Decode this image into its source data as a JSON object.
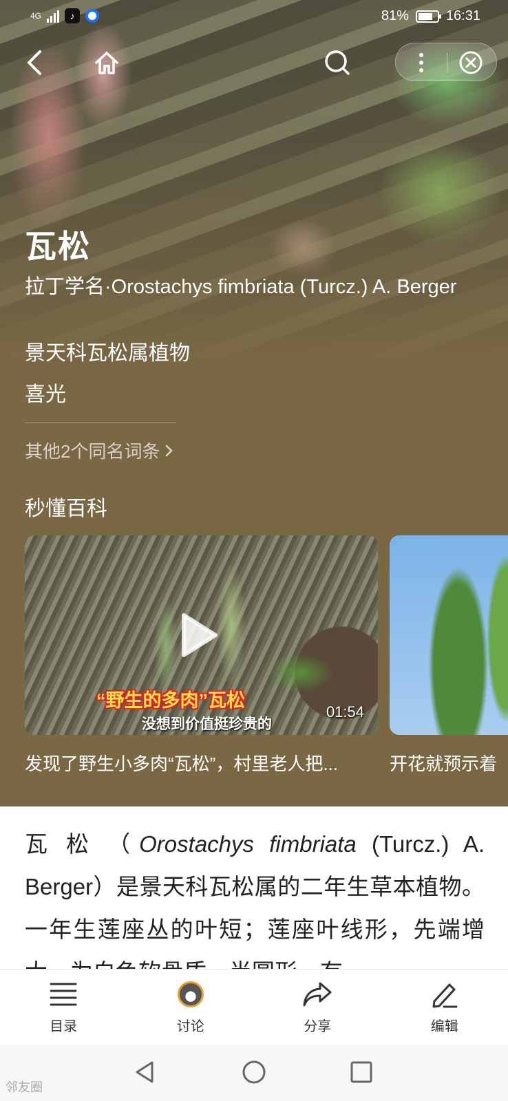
{
  "status_bar": {
    "network": "4G",
    "battery_percent": "81%",
    "battery_level": 0.81,
    "time": "16:31"
  },
  "nav": {
    "back_icon": "chevron-left-icon",
    "home_icon": "home-icon",
    "search_icon": "search-icon",
    "more_icon": "more-vertical-icon",
    "close_icon": "close-circle-icon"
  },
  "entry": {
    "title": "瓦松",
    "latin_label": "拉丁学名·",
    "latin_name": "Orostachys fimbriata (Turcz.) A. Berger",
    "family": "景天科瓦松属植物",
    "habit": "喜光",
    "other_entries": "其他2个同名词条"
  },
  "section": {
    "title": "秒懂百科"
  },
  "videos": [
    {
      "caption_main": "“野生的多肉”瓦松",
      "caption_sub": "没想到价值挺珍贵的",
      "duration": "01:54",
      "title": "发现了野生小多肉“瓦松”，村里老人把..."
    },
    {
      "title": "开花就预示着"
    }
  ],
  "intro": {
    "name": "瓦松",
    "open_paren": "（",
    "latin_italic": "Orostachys fimbriata",
    "authority": "(Turcz.) A. Berger",
    "text_after": "）是景天科瓦松属的二年生草本植物。一年生莲座丛的叶短；莲座叶线形，先端增大，为白色软骨质，半圆形，有"
  },
  "toolbar": {
    "catalog": "目录",
    "discuss": "讨论",
    "share": "分享",
    "edit": "编辑"
  },
  "watermark": "邻友圈",
  "colors": {
    "hero_bg": "#7a6744",
    "caption_yellow": "#ffe14a",
    "caption_red": "#d22"
  }
}
